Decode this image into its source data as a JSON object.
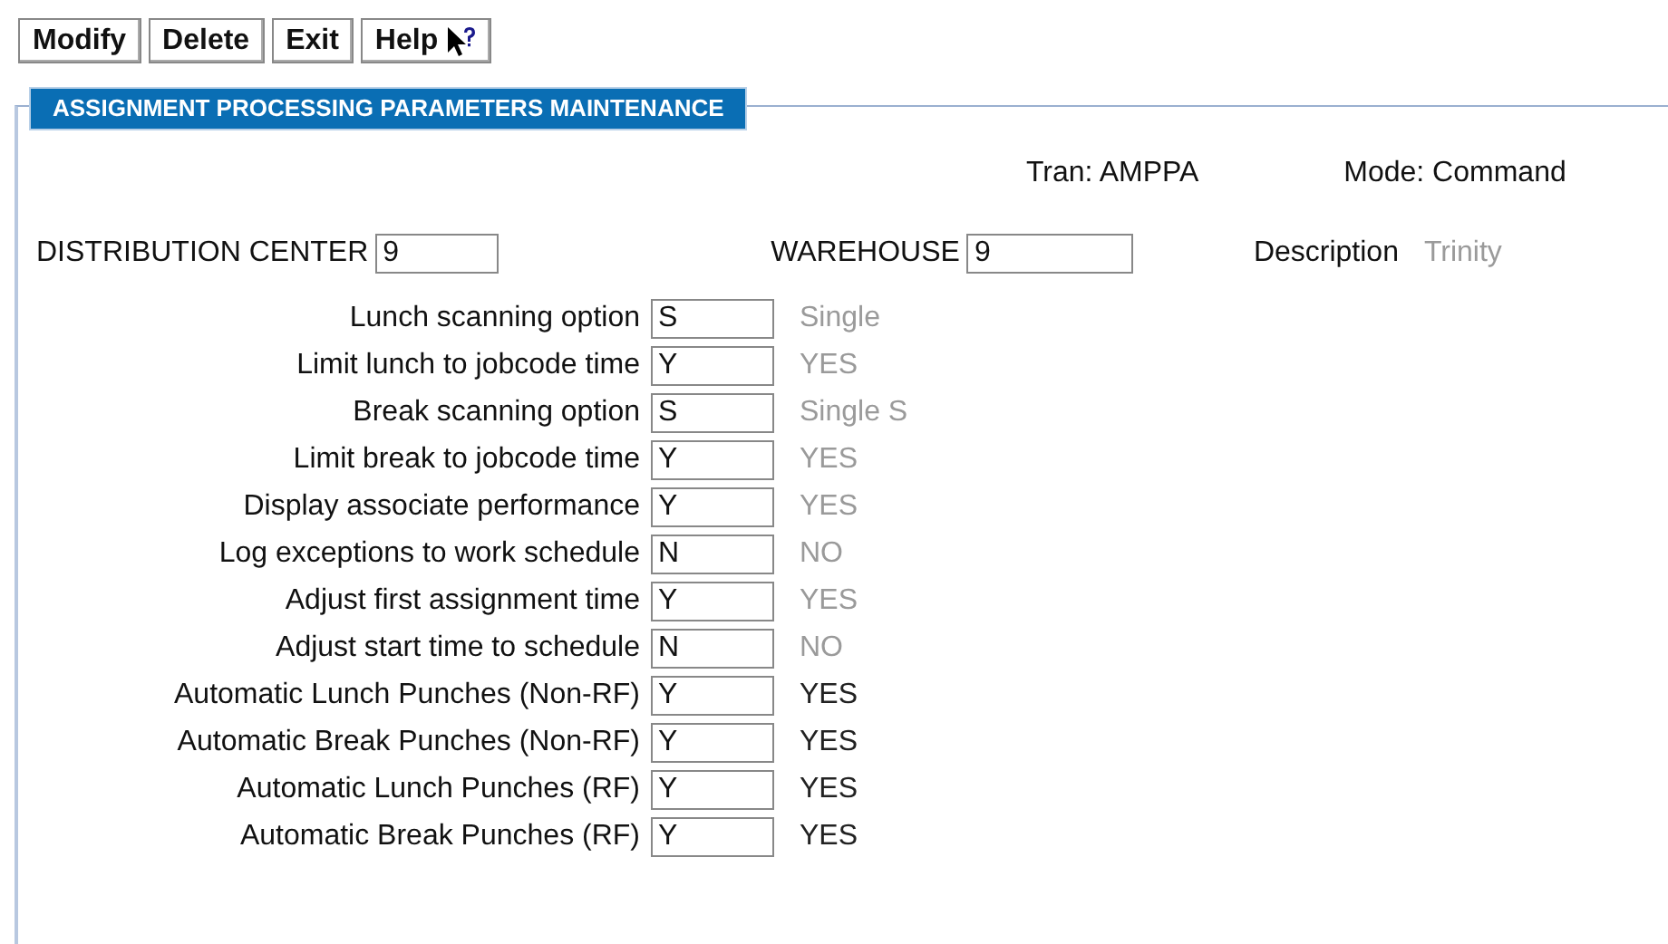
{
  "toolbar": {
    "buttons": [
      {
        "label": "Modify",
        "kind": "plain"
      },
      {
        "label": "Delete",
        "kind": "plain"
      },
      {
        "label": "Exit",
        "kind": "plain"
      },
      {
        "label": "Help",
        "kind": "help"
      }
    ]
  },
  "panel": {
    "title": "ASSIGNMENT PROCESSING PARAMETERS MAINTENANCE"
  },
  "tran": {
    "label": "Tran:",
    "value": "AMPPA"
  },
  "mode": {
    "label": "Mode:",
    "value": "Command"
  },
  "distribution_center": {
    "label": "DISTRIBUTION CENTER",
    "value": "9"
  },
  "warehouse": {
    "label": "WAREHOUSE",
    "value": "9"
  },
  "description": {
    "label": "Description",
    "value": "Trinity"
  },
  "parameters": [
    {
      "label": "Lunch scanning option",
      "value": "S",
      "meaning": "Single",
      "muted": true
    },
    {
      "label": "Limit lunch to jobcode time",
      "value": "Y",
      "meaning": "YES",
      "muted": true
    },
    {
      "label": "Break scanning option",
      "value": "S",
      "meaning": "Single S",
      "muted": true
    },
    {
      "label": "Limit break to jobcode time",
      "value": "Y",
      "meaning": "YES",
      "muted": true
    },
    {
      "label": "Display associate performance",
      "value": "Y",
      "meaning": "YES",
      "muted": true
    },
    {
      "label": "Log exceptions to work schedule",
      "value": "N",
      "meaning": "NO",
      "muted": true
    },
    {
      "label": "Adjust first assignment time",
      "value": "Y",
      "meaning": "YES",
      "muted": true
    },
    {
      "label": "Adjust start time to schedule",
      "value": "N",
      "meaning": "NO",
      "muted": true
    },
    {
      "label": "Automatic Lunch Punches (Non-RF)",
      "value": "Y",
      "meaning": "YES",
      "muted": false
    },
    {
      "label": "Automatic Break Punches (Non-RF)",
      "value": "Y",
      "meaning": "YES",
      "muted": false
    },
    {
      "label": "Automatic Lunch Punches (RF)",
      "value": "Y",
      "meaning": "YES",
      "muted": false
    },
    {
      "label": "Automatic Break Punches (RF)",
      "value": "Y",
      "meaning": "YES",
      "muted": false
    }
  ]
}
